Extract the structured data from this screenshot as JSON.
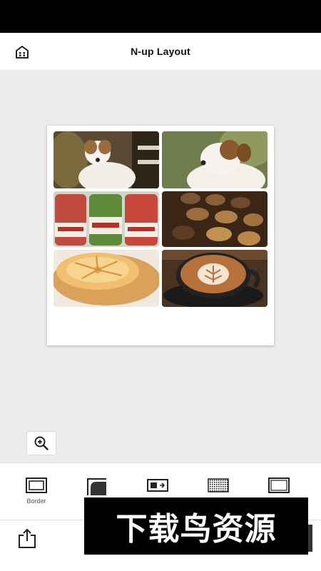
{
  "header": {
    "title": "N-up Layout",
    "home_icon": "home-icon"
  },
  "photos": [
    {
      "subject": "dog"
    },
    {
      "subject": "dog"
    },
    {
      "subject": "sweet-shop-jars"
    },
    {
      "subject": "chocolates"
    },
    {
      "subject": "fruit-tart"
    },
    {
      "subject": "latte-art"
    }
  ],
  "zoom": {
    "icon": "zoom-in-icon"
  },
  "toolbar": {
    "tools": [
      {
        "label": "Border",
        "icon": "border-frame-icon"
      },
      {
        "label": "",
        "icon": "corner-radius-icon"
      },
      {
        "label": "",
        "icon": "layout-icon"
      },
      {
        "label": "",
        "icon": "pattern-icon"
      },
      {
        "label": "",
        "icon": "frame-icon"
      }
    ]
  },
  "bottom": {
    "share_icon": "share-icon"
  },
  "watermark": {
    "text": "下载鸟资源"
  },
  "colors": {
    "canvas": "#ececee",
    "sheet": "#ffffff",
    "statusbar": "#000000"
  }
}
